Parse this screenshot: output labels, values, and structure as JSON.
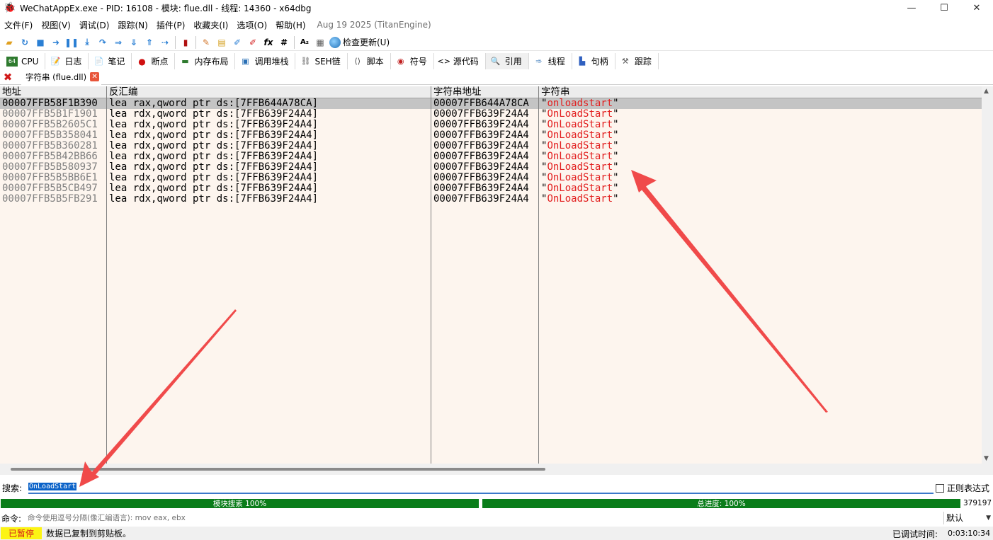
{
  "window": {
    "title": "WeChatAppEx.exe - PID: 16108 - 模块: flue.dll - 线程: 14360 - x64dbg",
    "minimize": "—",
    "maximize": "☐",
    "close": "✕"
  },
  "menu": {
    "items": [
      "文件(F)",
      "视图(V)",
      "调试(D)",
      "跟踪(N)",
      "插件(P)",
      "收藏夹(I)",
      "选项(O)",
      "帮助(H)"
    ],
    "build": "Aug 19 2025 (TitanEngine)"
  },
  "toolbar": {
    "check_update": "检查更新(U)"
  },
  "tabs": [
    {
      "label": "CPU",
      "icon": "cpu-icon"
    },
    {
      "label": "日志",
      "icon": "log-icon"
    },
    {
      "label": "笔记",
      "icon": "notes-icon"
    },
    {
      "label": "断点",
      "icon": "breakpoint-icon"
    },
    {
      "label": "内存布局",
      "icon": "memory-icon"
    },
    {
      "label": "调用堆栈",
      "icon": "callstack-icon"
    },
    {
      "label": "SEH链",
      "icon": "seh-icon"
    },
    {
      "label": "脚本",
      "icon": "script-icon"
    },
    {
      "label": "符号",
      "icon": "symbol-icon"
    },
    {
      "label": "源代码",
      "icon": "source-icon"
    },
    {
      "label": "引用",
      "icon": "references-icon"
    },
    {
      "label": "线程",
      "icon": "threads-icon"
    },
    {
      "label": "句柄",
      "icon": "handles-icon"
    },
    {
      "label": "跟踪",
      "icon": "trace-icon"
    }
  ],
  "subtab": {
    "label": "字符串 (flue.dll)"
  },
  "table": {
    "headers": {
      "address": "地址",
      "disassembly": "反汇编",
      "string_address": "字符串地址",
      "string": "字符串"
    },
    "rows": [
      {
        "address": "00007FFB58F1B390",
        "disassembly": "lea rax,qword ptr ds:[7FFB644A78CA]",
        "string_address": "00007FFB644A78CA",
        "string": "onloadstart"
      },
      {
        "address": "00007FFB5B1F1901",
        "disassembly": "lea rdx,qword ptr ds:[7FFB639F24A4]",
        "string_address": "00007FFB639F24A4",
        "string": "OnLoadStart"
      },
      {
        "address": "00007FFB5B2605C1",
        "disassembly": "lea rdx,qword ptr ds:[7FFB639F24A4]",
        "string_address": "00007FFB639F24A4",
        "string": "OnLoadStart"
      },
      {
        "address": "00007FFB5B358041",
        "disassembly": "lea rdx,qword ptr ds:[7FFB639F24A4]",
        "string_address": "00007FFB639F24A4",
        "string": "OnLoadStart"
      },
      {
        "address": "00007FFB5B360281",
        "disassembly": "lea rdx,qword ptr ds:[7FFB639F24A4]",
        "string_address": "00007FFB639F24A4",
        "string": "OnLoadStart"
      },
      {
        "address": "00007FFB5B42BB66",
        "disassembly": "lea rdx,qword ptr ds:[7FFB639F24A4]",
        "string_address": "00007FFB639F24A4",
        "string": "OnLoadStart"
      },
      {
        "address": "00007FFB5B580937",
        "disassembly": "lea rdx,qword ptr ds:[7FFB639F24A4]",
        "string_address": "00007FFB639F24A4",
        "string": "OnLoadStart"
      },
      {
        "address": "00007FFB5B5BB6E1",
        "disassembly": "lea rdx,qword ptr ds:[7FFB639F24A4]",
        "string_address": "00007FFB639F24A4",
        "string": "OnLoadStart"
      },
      {
        "address": "00007FFB5B5CB497",
        "disassembly": "lea rdx,qword ptr ds:[7FFB639F24A4]",
        "string_address": "00007FFB639F24A4",
        "string": "OnLoadStart"
      },
      {
        "address": "00007FFB5B5FB291",
        "disassembly": "lea rdx,qword ptr ds:[7FFB639F24A4]",
        "string_address": "00007FFB639F24A4",
        "string": "OnLoadStart"
      }
    ]
  },
  "search": {
    "label": "搜索:",
    "value": "OnLoadStart",
    "regex_label": "正则表达式"
  },
  "progress": {
    "module_search": "模块搜索 100%",
    "total": "总进度: 100%",
    "count": "379197"
  },
  "command": {
    "label": "命令:",
    "placeholder": "命令使用逗号分隔(像汇编语言): mov eax, ebx",
    "mode": "默认"
  },
  "status": {
    "state": "已暂停",
    "message": "数据已复制到剪贴板。",
    "time_label": "已调试时间:",
    "time": "0:03:10:34"
  },
  "colors": {
    "string_red": "#e21f1f",
    "table_bg": "#fdf5ee",
    "progress_green": "#0a7d1a",
    "paused_yellow": "#fcf414",
    "annotation_red": "#f04a4a"
  }
}
